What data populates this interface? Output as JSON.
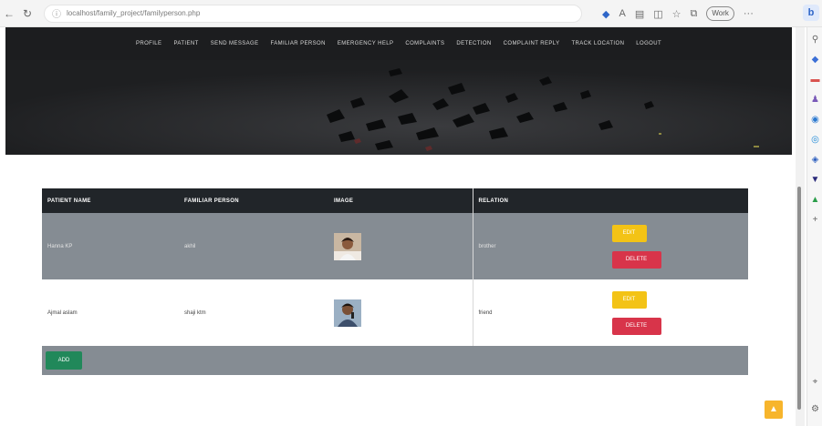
{
  "browser": {
    "url": "localhost/family_project/familyperson.php",
    "profile_label": "Work"
  },
  "nav": {
    "items": [
      "PROFILE",
      "PATIENT",
      "SEND MESSAGE",
      "FAMILIAR PERSON",
      "EMERGENCY HELP",
      "COMPLAINTS",
      "DETECTION",
      "COMPLAINT REPLY",
      "TRACK LOCATION",
      "LOGOUT"
    ]
  },
  "table": {
    "headers": [
      "PATIENT NAME",
      "FAMILIAR PERSON",
      "IMAGE",
      "RELATION"
    ],
    "rows": [
      {
        "patient": "Hanna KP",
        "familiar_person": "akhil",
        "relation": "brother",
        "edit_label": "EDIT",
        "delete_label": "DELETE"
      },
      {
        "patient": "Ajmal aslam",
        "familiar_person": "shaji ktm",
        "relation": "friend",
        "edit_label": "EDIT",
        "delete_label": "DELETE"
      }
    ],
    "add_label": "ADD"
  },
  "colors": {
    "navbar": "#1c1d1f",
    "table_header": "#212529",
    "row_grey": "#858c93",
    "edit": "#f3c316",
    "delete": "#d8344a",
    "add": "#21885a"
  }
}
